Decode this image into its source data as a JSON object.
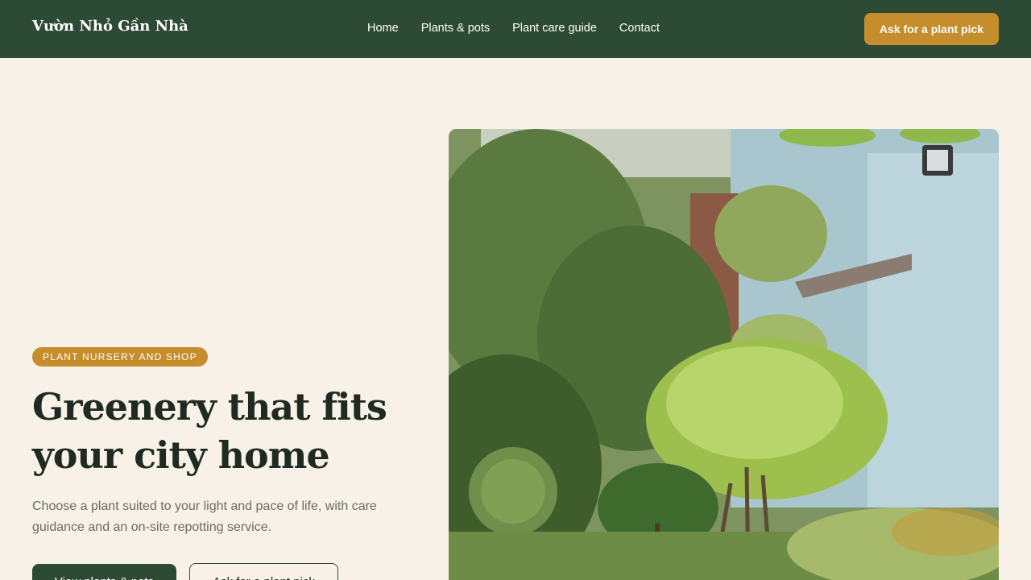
{
  "header": {
    "brand": "Vườn Nhỏ Gần Nhà",
    "nav": [
      "Home",
      "Plants & pots",
      "Plant care guide",
      "Contact"
    ],
    "cta": "Ask for a plant pick"
  },
  "hero": {
    "badge": "PLANT NURSERY AND SHOP",
    "title": "Greenery that fits your city home",
    "subtitle": "Choose a plant suited to your light and pace of life, with care guidance and an on-site repotting service.",
    "primary_button": "View plants & pots",
    "secondary_button": "Ask for a plant pick"
  },
  "colors": {
    "header_bg": "#2d4a34",
    "page_bg": "#f7f1e7",
    "accent": "#c58d2c",
    "text_dark": "#1f2a22",
    "text_muted": "#6a6c63"
  }
}
